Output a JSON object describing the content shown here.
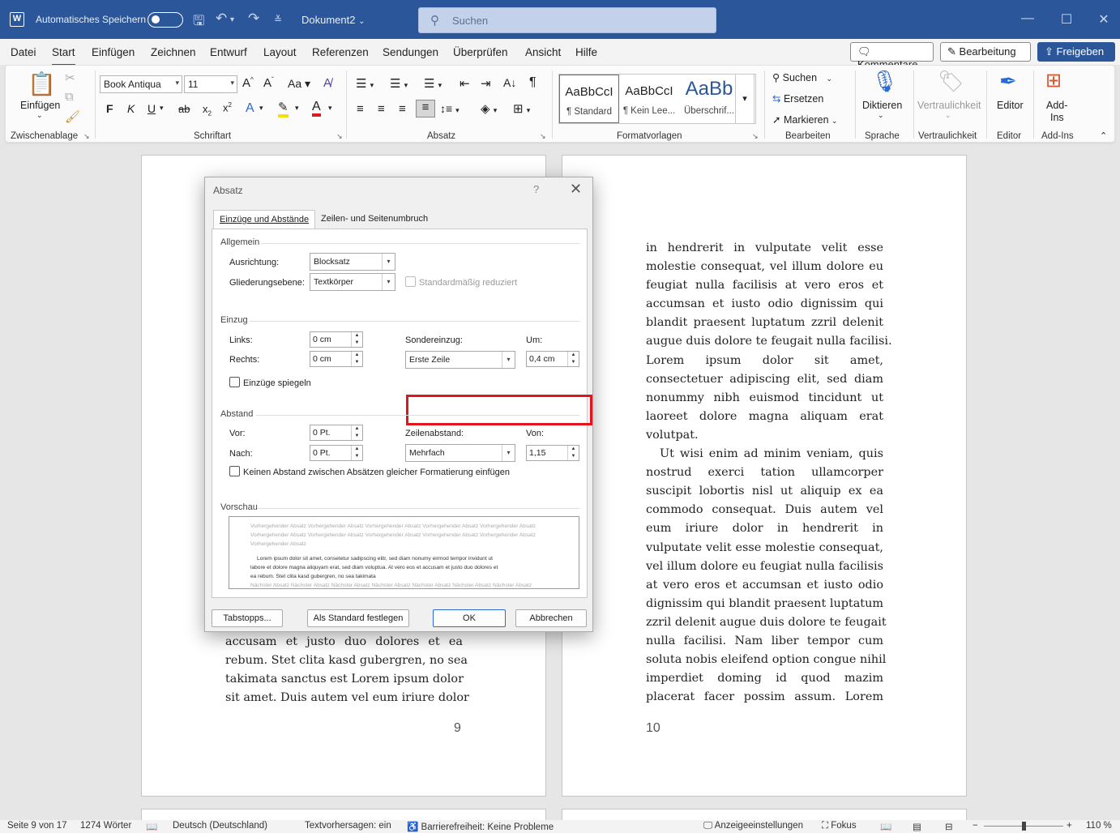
{
  "titlebar": {
    "autosave_label": "Automatisches Speichern",
    "doc_name": "Dokument2",
    "search_placeholder": "Suchen"
  },
  "menu": {
    "tabs": [
      "Datei",
      "Start",
      "Einfügen",
      "Zeichnen",
      "Entwurf",
      "Layout",
      "Referenzen",
      "Sendungen",
      "Überprüfen",
      "Ansicht",
      "Hilfe"
    ],
    "active_tab": "Start",
    "comments_label": "Kommentare",
    "editing_label": "Bearbeitung",
    "share_label": "Freigeben"
  },
  "ribbon": {
    "clipboard": {
      "paste_label": "Einfügen",
      "group_label": "Zwischenablage"
    },
    "font": {
      "font_name": "Book Antiqua",
      "font_size": "11",
      "group_label": "Schriftart",
      "bold": "F",
      "italic": "K",
      "underline": "U",
      "strike": "ab"
    },
    "paragraph": {
      "group_label": "Absatz"
    },
    "styles": {
      "group_label": "Formatvorlagen",
      "items": [
        {
          "sample": "AaBbCcI",
          "name": "¶ Standard"
        },
        {
          "sample": "AaBbCcI",
          "name": "¶ Kein Lee..."
        },
        {
          "sample": "AaBb",
          "name": "Überschrif..."
        }
      ]
    },
    "editing": {
      "group_label": "Bearbeiten",
      "find": "Suchen",
      "replace": "Ersetzen",
      "select": "Markieren"
    },
    "voice": {
      "dictate": "Diktieren",
      "group_label": "Sprache"
    },
    "sensitivity": {
      "label": "Vertraulichkeit",
      "group_label": "Vertraulichkeit"
    },
    "editor": {
      "label": "Editor",
      "group_label": "Editor"
    },
    "addins": {
      "label_line1": "Add-",
      "label_line2": "Ins",
      "group_label": "Add-Ins"
    }
  },
  "dialog": {
    "title": "Absatz",
    "help": "?",
    "tabs": [
      "Einzüge und Abstände",
      "Zeilen- und Seitenumbruch"
    ],
    "general": {
      "section": "Allgemein",
      "alignment_label": "Ausrichtung:",
      "alignment_value": "Blocksatz",
      "outline_label": "Gliederungsebene:",
      "outline_value": "Textkörper",
      "collapsed_label": "Standardmäßig reduziert"
    },
    "indent": {
      "section": "Einzug",
      "left_label": "Links:",
      "left_value": "0 cm",
      "right_label": "Rechts:",
      "right_value": "0 cm",
      "special_label": "Sonderеinzug:",
      "special_value": "Erste Zeile",
      "by_label": "Um:",
      "by_value": "0,4 cm",
      "mirror_label": "Einzüge spiegeln"
    },
    "spacing": {
      "section": "Abstand",
      "before_label": "Vor:",
      "before_value": "0 Pt.",
      "after_label": "Nach:",
      "after_value": "0 Pt.",
      "line_label": "Zeilenabstand:",
      "line_value": "Mehrfach",
      "at_label": "Von:",
      "at_value": "1,15",
      "no_space_label": "Keinen Abstand zwischen Absätzen gleicher Formatierung einfügen"
    },
    "preview": {
      "section": "Vorschau",
      "prev_lines": [
        "Vorhergehender Absatz Vorhergehender Absatz Vorhergehender Absatz Vorhergehender Absatz Vorhergehender Absatz",
        "Vorhergehender Absatz Vorhergehender Absatz Vorhergehender Absatz Vorhergehender Absatz Vorhergehender Absatz",
        "Vorhergehender Absatz"
      ],
      "cur_lines": [
        "Lorem ipsum dolor sit amet, consetetur sadipscing elitr, sed diam nonumy eirmod tempor invidunt ut",
        "labore et dolore magna aliquyam erat, sed diam voluptua. At vero eos et accusam et justo duo dolores et",
        "ea rebum. Stet clita kasd gubergren, no sea takimata"
      ],
      "next_line": "Nächster Absatz Nächster Absatz Nächster Absatz Nächster Absatz Nächster Absatz Nächster Absatz Nächster Absatz"
    },
    "buttons": {
      "tabs": "Tabstopps...",
      "default": "Als Standard festlegen",
      "ok": "OK",
      "cancel": "Abbrechen"
    }
  },
  "page_left": {
    "lines": [
      "accusam et justo duo dolores et ea",
      "rebum. Stet clita kasd gubergren, no sea",
      "takimata sanctus est Lorem ipsum dolor",
      "sit amet. Duis autem vel eum iriure dolor"
    ],
    "page_number": "9"
  },
  "page_right": {
    "lines": [
      "in hendrerit in vulputate velit esse",
      "molestie consequat, vel illum dolore eu",
      "feugiat nulla facilisis at vero eros et",
      "accumsan et iusto odio dignissim qui",
      "blandit praesent luptatum zzril delenit",
      "augue duis dolore te feugait nulla facilisi.",
      "Lorem ipsum dolor sit amet,",
      "consectetuer adipiscing elit, sed diam",
      "nonummy nibh euismod tincidunt ut",
      "laoreet dolore magna aliquam erat",
      "volutpat.",
      "Ut wisi enim ad minim veniam, quis",
      "nostrud exerci tation ullamcorper",
      "suscipit lobortis nisl ut aliquip ex ea",
      "commodo consequat. Duis autem vel",
      "eum iriure dolor in hendrerit in",
      "vulputate velit esse molestie consequat,",
      "vel illum dolore eu feugiat nulla facilisis",
      "at vero eros et accumsan et iusto odio",
      "dignissim qui blandit praesent luptatum",
      "zzril delenit augue duis dolore te feugait",
      "nulla facilisi. Nam liber tempor cum",
      "soluta nobis eleifend option congue nihil",
      "imperdiet doming id quod mazim",
      "placerat facer possim assum. Lorem"
    ],
    "page_number": "10"
  },
  "statusbar": {
    "page": "Seite 9 von 17",
    "words": "1274 Wörter",
    "language": "Deutsch (Deutschland)",
    "predictions": "Textvorhersagen: ein",
    "accessibility": "Barrierefreiheit: Keine Probleme",
    "display_settings": "Anzeigeeinstellungen",
    "focus": "Fokus",
    "zoom": "110 %"
  },
  "colors": {
    "brand": "#2b579a",
    "highlight": "#e0151e"
  }
}
